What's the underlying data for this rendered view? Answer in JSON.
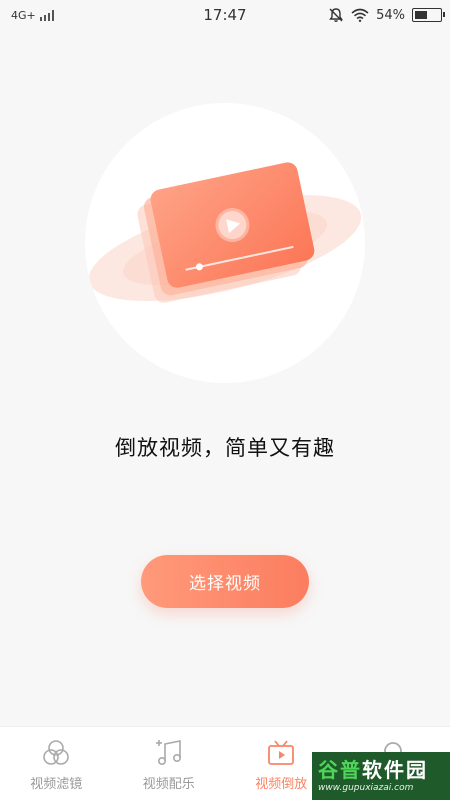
{
  "status_bar": {
    "network": "4G+",
    "time": "17:47",
    "battery_percent": "54%",
    "battery_level": 0.54,
    "icons": [
      "signal-icon",
      "bell-off-icon",
      "wifi-icon",
      "battery-icon"
    ]
  },
  "main": {
    "illustration": "video-player-illustration",
    "tagline": "倒放视频，简单又有趣",
    "select_button": "选择视频"
  },
  "tabs": [
    {
      "label": "视频滤镜",
      "icon": "filter-circles-icon",
      "active": false
    },
    {
      "label": "视频配乐",
      "icon": "music-note-icon",
      "active": false
    },
    {
      "label": "视频倒放",
      "icon": "video-play-icon",
      "active": true
    },
    {
      "label": "",
      "icon": "search-icon",
      "active": false
    }
  ],
  "watermark": {
    "brand_a": "谷普",
    "brand_b": "软件园",
    "url": "www.gupuxiazai.com"
  },
  "colors": {
    "accent": "#fa8466",
    "button_start": "#ff9a7a",
    "button_end": "#fb7d5f",
    "background": "#f7f7f7"
  }
}
